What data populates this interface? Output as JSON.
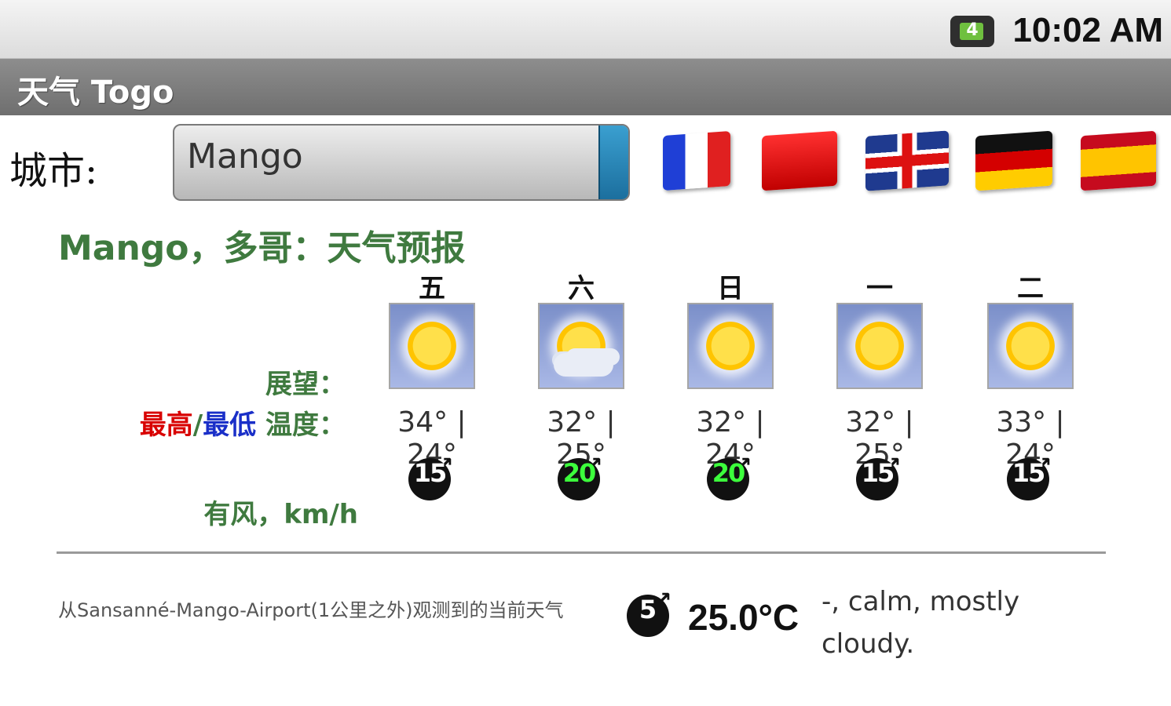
{
  "status_bar": {
    "time": "10:02 AM",
    "battery_icon": "battery-icon",
    "battery_level": "4"
  },
  "title_bar": {
    "title": "天气 Togo"
  },
  "city": {
    "label": "城市:",
    "selected": "Mango"
  },
  "flags": [
    "france-flag-icon",
    "china-flag-icon",
    "uk-flag-icon",
    "germany-flag-icon",
    "spain-flag-icon"
  ],
  "forecast": {
    "heading": "Mango，多哥：天气预报",
    "outlook_label": "展望：",
    "hilo_label_hi": "最高",
    "hilo_label_sep": "/",
    "hilo_label_lo": "最低",
    "hilo_label_rest": " 温度：",
    "wind_label": "有风，km/h",
    "days": [
      {
        "name": "五",
        "icon": "sunny-icon",
        "temp": "34° | 24°",
        "wind": "15",
        "wind_color": "#ffffff"
      },
      {
        "name": "六",
        "icon": "partly-cloudy-icon",
        "temp": "32° | 25°",
        "wind": "20",
        "wind_color": "#3cff3c"
      },
      {
        "name": "日",
        "icon": "sunny-icon",
        "temp": "32° | 24°",
        "wind": "20",
        "wind_color": "#3cff3c"
      },
      {
        "name": "一",
        "icon": "sunny-icon",
        "temp": "32° | 25°",
        "wind": "15",
        "wind_color": "#ffffff"
      },
      {
        "name": "二",
        "icon": "sunny-icon",
        "temp": "33° | 24°",
        "wind": "15",
        "wind_color": "#ffffff"
      }
    ]
  },
  "current": {
    "observation": "从Sansanné-Mango-Airport(1公里之外)观测到的当前天气",
    "wind": "5",
    "temperature": "25.0°C",
    "description": "-, calm, mostly cloudy."
  }
}
